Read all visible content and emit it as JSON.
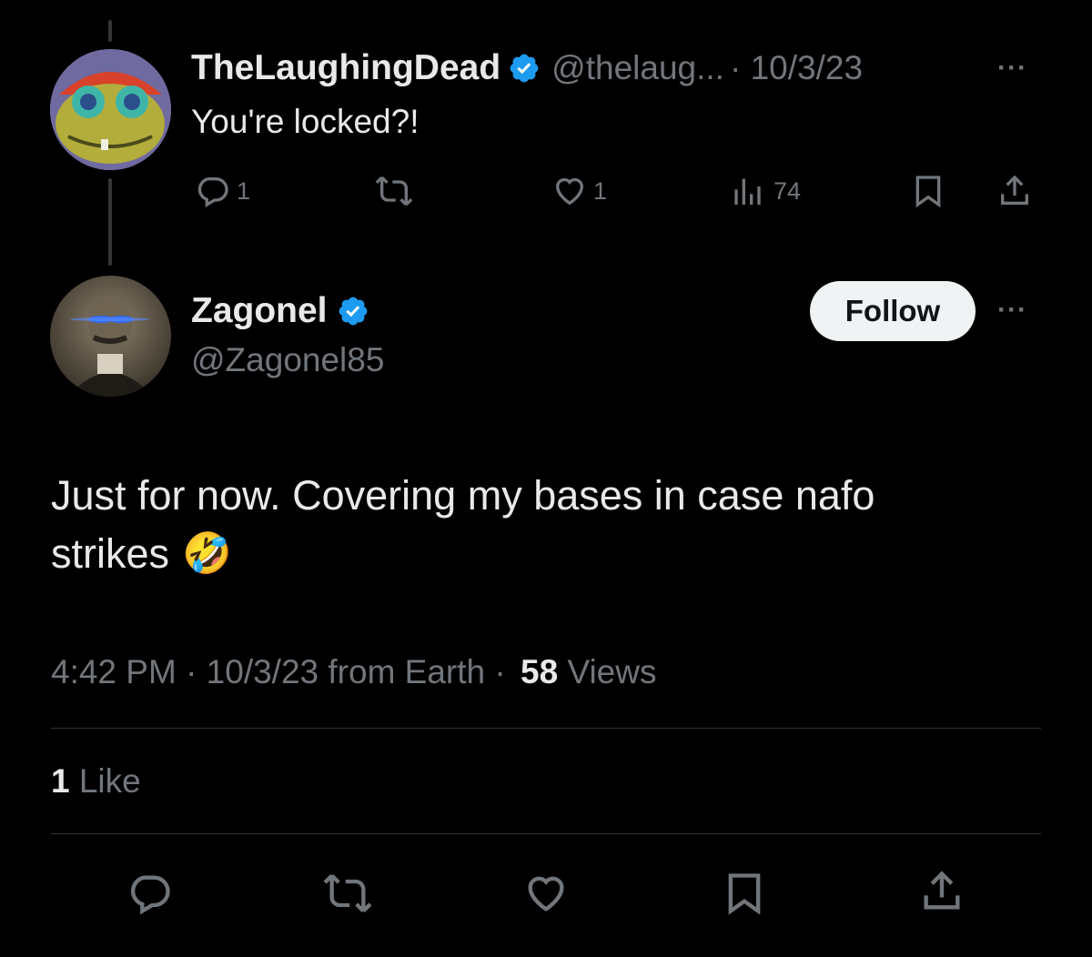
{
  "reply_to": {
    "display_name": "TheLaughingDead",
    "handle": "@thelaug...",
    "date": "· 10/3/23",
    "text": "You're locked?!",
    "more": "···",
    "actions": {
      "replies": "1",
      "likes": "1",
      "views": "74"
    }
  },
  "tweet": {
    "display_name": "Zagonel",
    "handle": "@Zagonel85",
    "follow_label": "Follow",
    "more": "···",
    "text_line1": "Just for now. Covering my bases in case nafo",
    "text_line2": "strikes",
    "emoji": "🤣",
    "meta_time": "4:42 PM · 10/3/23 from Earth ·",
    "meta_views_count": "58",
    "meta_views_label": "Views",
    "likes_count": "1",
    "likes_label": "Like"
  },
  "colors": {
    "background": "#000000",
    "text": "#e7e9ea",
    "muted": "#71767b",
    "verified": "#1d9bf0",
    "divider": "#2f3336"
  },
  "icons": [
    "reply-icon",
    "retweet-icon",
    "like-icon",
    "views-icon",
    "bookmark-icon",
    "share-icon",
    "verified-icon"
  ]
}
